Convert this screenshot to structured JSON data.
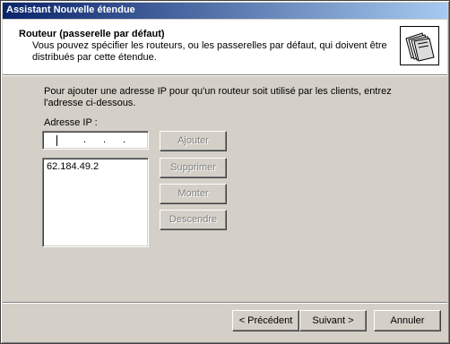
{
  "window": {
    "title": "Assistant Nouvelle étendue"
  },
  "header": {
    "title": "Routeur (passerelle par défaut)",
    "subtitle": "Vous pouvez spécifier les routeurs, ou les passerelles par défaut, qui doivent être distribués par cette étendue."
  },
  "body": {
    "instruction": "Pour ajouter une adresse IP pour qu'un routeur soit utilisé par les clients, entrez l'adresse ci-dessous.",
    "ip_label": "Adresse IP :",
    "ip_value": "",
    "list_items": [
      "62.184.49.2"
    ]
  },
  "buttons": {
    "add": "Ajouter",
    "remove": "Supprimer",
    "up": "Monter",
    "down": "Descendre"
  },
  "nav": {
    "back": "< Précédent",
    "next": "Suivant >",
    "cancel": "Annuler"
  },
  "colors": {
    "title_start": "#0a246a",
    "title_end": "#a6caf0",
    "face": "#d4d0c8"
  },
  "icons": {
    "header": "folders-icon"
  }
}
